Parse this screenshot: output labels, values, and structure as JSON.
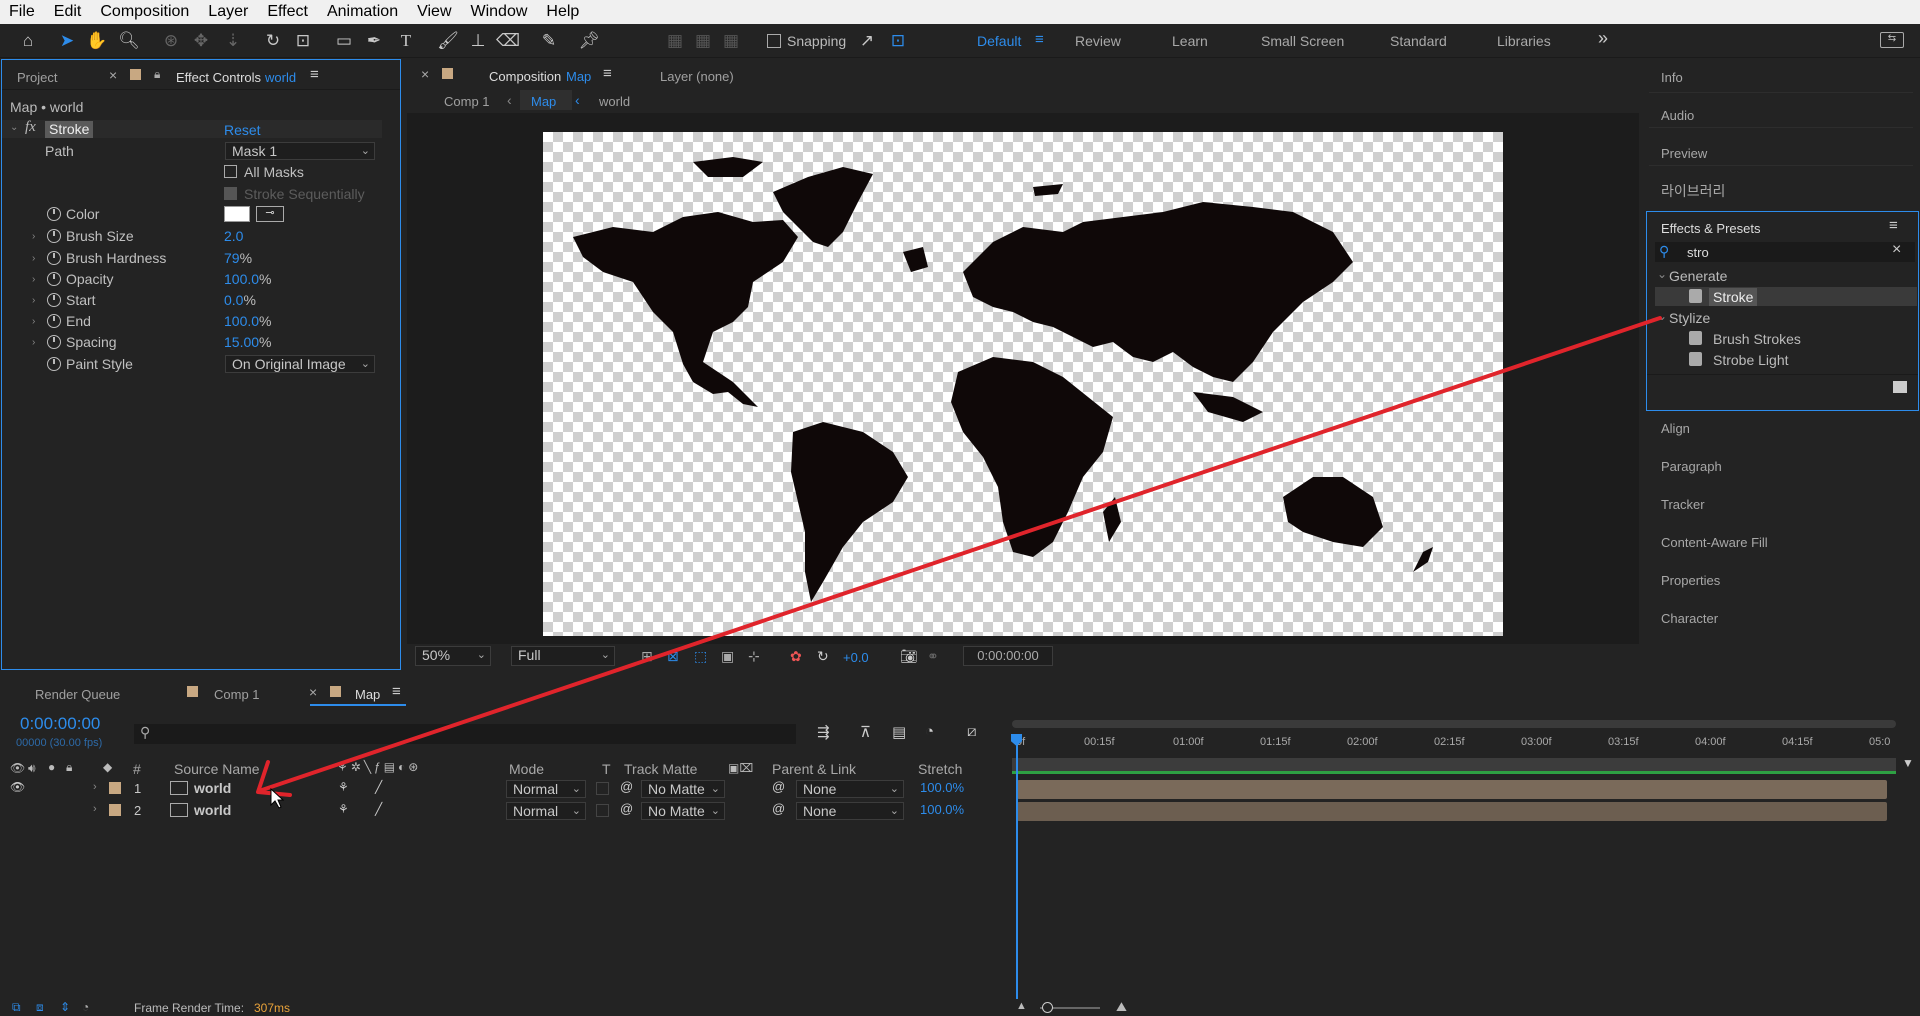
{
  "menu": [
    "File",
    "Edit",
    "Composition",
    "Layer",
    "Effect",
    "Animation",
    "View",
    "Window",
    "Help"
  ],
  "toolbar": {
    "snapping_label": "Snapping"
  },
  "workspaces": {
    "items": [
      "Default",
      "Review",
      "Learn",
      "Small Screen",
      "Standard",
      "Libraries"
    ],
    "active": "Default",
    "more": "»"
  },
  "left_panel": {
    "tab_project": "Project",
    "tab_effect_controls": "Effect Controls",
    "tab_effect_layer": "world",
    "breadcrumb": "Map • world",
    "effect_name": "Stroke",
    "fx": "fx",
    "reset": "Reset",
    "path_label": "Path",
    "path_value": "Mask 1",
    "all_masks": "All Masks",
    "stroke_seq": "Stroke Sequentially",
    "color_label": "Color",
    "props": [
      {
        "label": "Brush Size",
        "value": "2.0",
        "unit": ""
      },
      {
        "label": "Brush Hardness",
        "value": "79",
        "unit": "%"
      },
      {
        "label": "Opacity",
        "value": "100.0",
        "unit": "%"
      },
      {
        "label": "Start",
        "value": "0.0",
        "unit": "%"
      },
      {
        "label": "End",
        "value": "100.0",
        "unit": "%"
      },
      {
        "label": "Spacing",
        "value": "15.00",
        "unit": "%"
      }
    ],
    "paint_style_label": "Paint Style",
    "paint_style_value": "On Original Image"
  },
  "comp_panel": {
    "tab_composition": "Composition",
    "tab_comp_name": "Map",
    "tab_layer": "Layer (none)",
    "crumbs": [
      "Comp 1",
      "Map",
      "world"
    ],
    "zoom": "50%",
    "resolution": "Full",
    "exposure": "+0.0",
    "timecode": "0:00:00:00"
  },
  "right_panel": {
    "items_top": [
      "Info",
      "Audio",
      "Preview",
      "라이브러리"
    ],
    "effects_title": "Effects & Presets",
    "search_value": "stro",
    "groups": [
      {
        "name": "Generate",
        "items": [
          "Stroke"
        ]
      },
      {
        "name": "Stylize",
        "items": [
          "Brush Strokes",
          "Strobe Light"
        ]
      }
    ],
    "items_bottom": [
      "Align",
      "Paragraph",
      "Tracker",
      "Content-Aware Fill",
      "Properties",
      "Character"
    ]
  },
  "timeline": {
    "tabs": [
      "Render Queue",
      "Comp 1",
      "Map"
    ],
    "timecode": "0:00:00:00",
    "frames": "00000 (30.00 fps)",
    "columns": {
      "source": "Source Name",
      "num": "#",
      "mode": "Mode",
      "t": "T",
      "track_matte": "Track Matte",
      "parent": "Parent & Link",
      "stretch": "Stretch"
    },
    "layers": [
      {
        "num": "1",
        "name": "world",
        "mode": "Normal",
        "matte": "No Matte",
        "parent": "None",
        "stretch": "100.0%"
      },
      {
        "num": "2",
        "name": "world",
        "mode": "Normal",
        "matte": "No Matte",
        "parent": "None",
        "stretch": "100.0%"
      }
    ],
    "ruler": [
      "0f",
      "00:15f",
      "01:00f",
      "01:15f",
      "02:00f",
      "02:15f",
      "03:00f",
      "03:15f",
      "04:00f",
      "04:15f",
      "05:0"
    ]
  },
  "status": {
    "render_time_label": "Frame Render Time:",
    "render_time_value": "307ms"
  },
  "colors": {
    "accent": "#2d8ceb",
    "annotation": "#e0242b",
    "layer_bar": "#7a6a5a",
    "label_tan": "#c8a882"
  }
}
